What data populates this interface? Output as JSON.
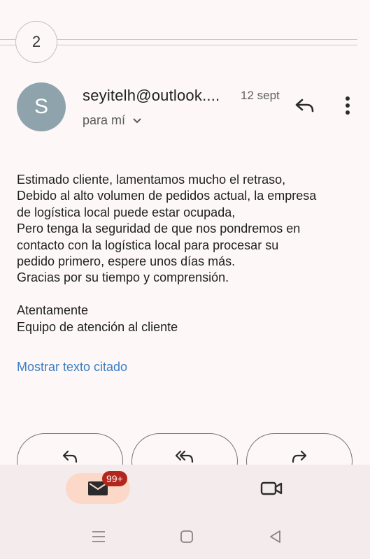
{
  "thread": {
    "message_count": "2"
  },
  "email": {
    "sender": "seyitelh@outlook....",
    "avatar_letter": "S",
    "date": "12 sept",
    "recipient_label": "para mí",
    "body_lines": [
      "Estimado cliente, lamentamos mucho el retraso,",
      "Debido al alto volumen de pedidos actual, la empresa",
      "de logística local puede estar ocupada,",
      "Pero tenga la seguridad de que nos pondremos en",
      "contacto con la logística local para procesar su",
      "pedido primero, espere unos días más.",
      "Gracias por su tiempo y comprensión.",
      "",
      "Atentamente",
      "Equipo de atención al cliente"
    ],
    "show_quoted_text": "Mostrar texto citado"
  },
  "bottom_nav": {
    "mail_unread_badge": "99+"
  },
  "colors": {
    "avatar": "#8ea3ac",
    "link": "#3d7fc4",
    "badge": "#b3261e",
    "mail_pill": "#fbd8c8"
  },
  "icons": [
    "reply-icon",
    "more-vert-icon",
    "chevron-down-icon",
    "reply-all-icon",
    "forward-icon",
    "mail-icon",
    "video-icon",
    "menu-icon",
    "home-icon",
    "back-icon"
  ]
}
